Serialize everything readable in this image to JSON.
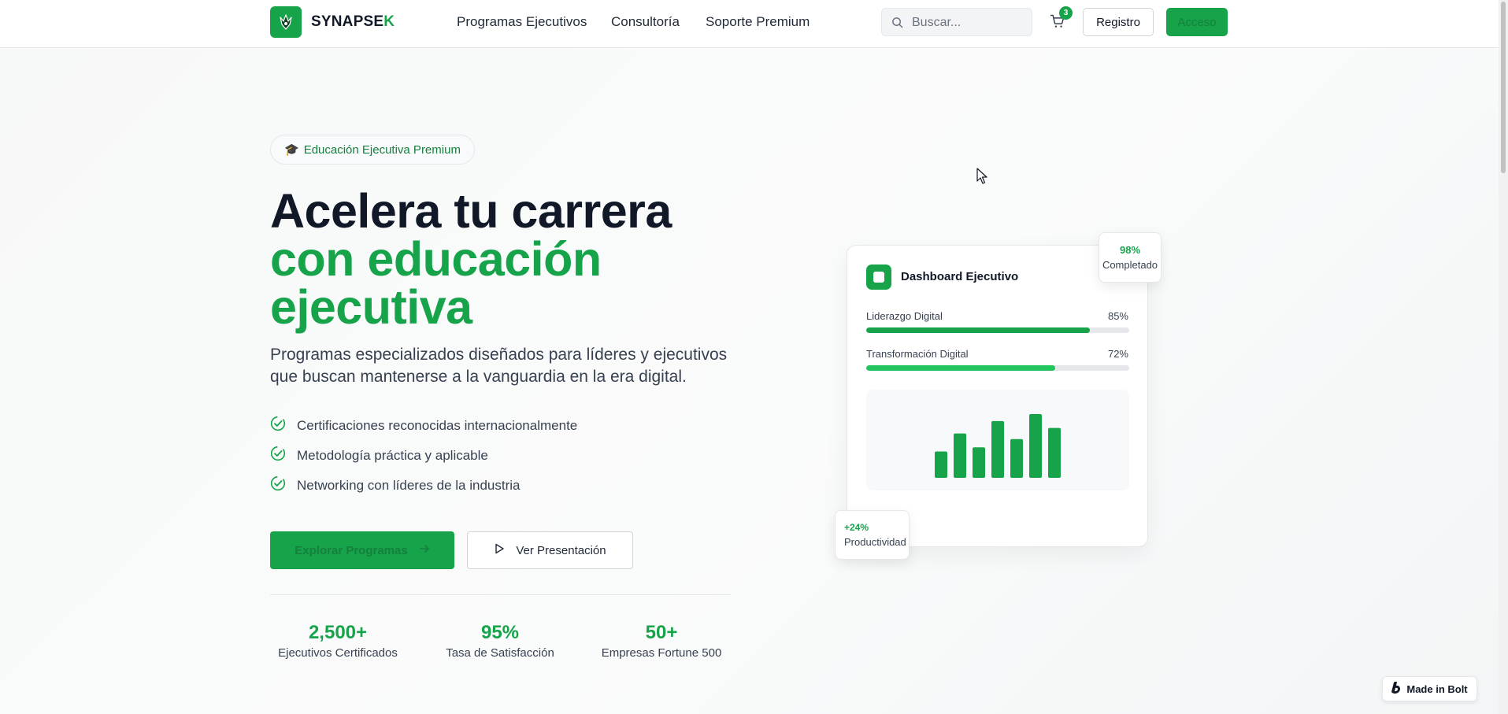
{
  "header": {
    "brand_main": "SYNAPSE",
    "brand_accent": "K",
    "nav": [
      "Programas Ejecutivos",
      "Consultoría",
      "Soporte Premium"
    ],
    "search_placeholder": "Buscar...",
    "cart_count": "3",
    "registro_label": "Registro",
    "acceso_label": "Acceso"
  },
  "hero": {
    "badge_icon": "🎓",
    "badge_text": "Educación Ejecutiva Premium",
    "title_line1": "Acelera tu carrera",
    "title_line2": "con educación",
    "title_line3": "ejecutiva",
    "subtitle": "Programas especializados diseñados para líderes y ejecutivos que buscan mantenerse a la vanguardia en la era digital.",
    "features": [
      "Certificaciones reconocidas internacionalmente",
      "Metodología práctica y aplicable",
      "Networking con líderes de la industria"
    ],
    "primary_button": "Explorar Programas",
    "secondary_button": "Ver Presentación",
    "stats": [
      {
        "value": "2,500+",
        "label": "Ejecutivos Certificados"
      },
      {
        "value": "95%",
        "label": "Tasa de Satisfacción"
      },
      {
        "value": "50+",
        "label": "Empresas Fortune 500"
      }
    ]
  },
  "dashboard": {
    "title": "Dashboard Ejecutivo",
    "metrics": [
      {
        "label": "Liderazgo Digital",
        "value_text": "85%",
        "fraction": 0.85,
        "color": "#16a34a"
      },
      {
        "label": "Transformación Digital",
        "value_text": "72%",
        "fraction": 0.72,
        "color": "#22c55e"
      }
    ],
    "bars": [
      0.38,
      0.64,
      0.44,
      0.82,
      0.56,
      0.92,
      0.72
    ],
    "float_completed_value": "98%",
    "float_completed_label": "Completado",
    "float_productivity_value": "+24%",
    "float_productivity_label": "Productividad"
  },
  "footer_badge": "Made in Bolt",
  "colors": {
    "brand_green": "#16a34a",
    "light_green": "#22c55e",
    "text_dark": "#111827"
  },
  "icons": [
    "logo-icon",
    "search-icon",
    "cart-icon",
    "graduation-cap-icon",
    "check-circle-icon",
    "arrow-right-icon",
    "play-icon",
    "bolt-logo-icon",
    "cursor-icon"
  ]
}
